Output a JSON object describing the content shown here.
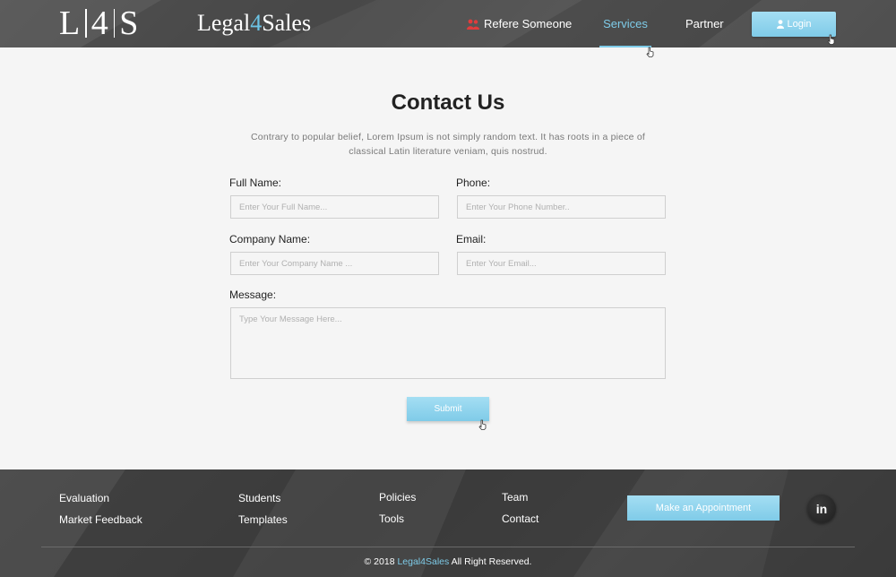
{
  "header": {
    "logo_left": "L",
    "logo_mid": "4",
    "logo_right": "S",
    "brand_pre": "Legal",
    "brand_accent": "4",
    "brand_post": "Sales",
    "nav": {
      "refer": "Refere Someone",
      "services": "Services",
      "partner": "Partner"
    },
    "login_label": "Login"
  },
  "main": {
    "title": "Contact Us",
    "intro": "Contrary to popular belief, Lorem Ipsum is not simply random text. It has roots in a piece of classical Latin literature veniam, quis nostrud.",
    "form": {
      "full_name_label": "Full Name:",
      "full_name_placeholder": "Enter Your Full Name...",
      "phone_label": "Phone:",
      "phone_placeholder": "Enter Your Phone Number..",
      "company_label": "Company Name:",
      "company_placeholder": "Enter Your Company Name ...",
      "email_label": "Email:",
      "email_placeholder": "Enter Your Email...",
      "message_label": "Message:",
      "message_placeholder": "Type Your Message Here...",
      "submit_label": "Submit"
    }
  },
  "footer": {
    "col1": [
      "Evaluation",
      "Market Feedback"
    ],
    "col2": [
      "Students",
      "Templates"
    ],
    "col3": [
      "Policies",
      "Tools"
    ],
    "col4": [
      "Team",
      "Contact"
    ],
    "appointment_label": "Make an Appointment",
    "linkedin_label": "in",
    "copyright_pre": "© 2018",
    "copyright_brand": "Legal4Sales",
    "copyright_post": "All Right Reserved."
  },
  "colors": {
    "accent": "#7ecbe8",
    "button": "#8fd3ec",
    "header_bg": "#505050",
    "footer_bg": "#424242",
    "icon_red": "#e03c3c"
  },
  "icons": [
    "people-icon",
    "user-icon",
    "hand-cursor-icon",
    "linkedin-icon"
  ]
}
